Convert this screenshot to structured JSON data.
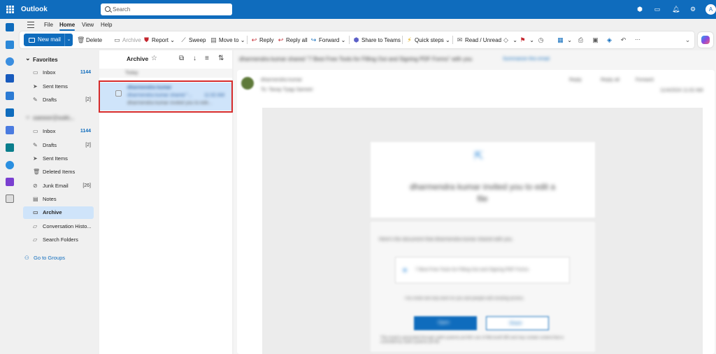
{
  "app": {
    "name": "Outlook",
    "search_placeholder": "Search",
    "avatar_letter": "A"
  },
  "tabs": [
    "File",
    "Home",
    "View",
    "Help"
  ],
  "ribbon": {
    "new_mail": "New mail",
    "delete": "Delete",
    "archive": "Archive",
    "report": "Report",
    "sweep": "Sweep",
    "move_to": "Move to",
    "reply": "Reply",
    "reply_all": "Reply all",
    "forward": "Forward",
    "share_to_teams": "Share to Teams",
    "quick_steps": "Quick steps",
    "read_unread": "Read / Unread",
    "more": "···"
  },
  "folders": {
    "favorites_header": "Favorites",
    "favorites": [
      {
        "label": "Inbox",
        "count": "1144"
      },
      {
        "label": "Sent Items",
        "count": ""
      },
      {
        "label": "Drafts",
        "count": "[2]"
      }
    ],
    "account_header": "sameer@sukt...",
    "account": [
      {
        "label": "Inbox",
        "count": "1144"
      },
      {
        "label": "Drafts",
        "count": "[2]"
      },
      {
        "label": "Sent Items",
        "count": ""
      },
      {
        "label": "Deleted Items",
        "count": ""
      },
      {
        "label": "Junk Email",
        "count": "[26]"
      },
      {
        "label": "Notes",
        "count": ""
      },
      {
        "label": "Archive",
        "count": ""
      },
      {
        "label": "Conversation Histo...",
        "count": ""
      },
      {
        "label": "Search Folders",
        "count": ""
      }
    ],
    "go_to_groups": "Go to Groups"
  },
  "list": {
    "title": "Archive",
    "group": "Today",
    "item": {
      "sender": "dharmendra kumar",
      "subject": "dharmendra kumar shared \"...",
      "time": "11:02 AM",
      "preview": "dharmendra kumar invited you to edit..."
    }
  },
  "reading": {
    "subject": "dharmendra kumar shared \"7 Best Free Tools for Filling Out and Signing PDF Forms\" with you",
    "summarize": "Summarize this email",
    "from": "dharmendra kumar",
    "to": "To: Tanay Tyagi   Sameer",
    "date": "11/4/2024 11:02 AM",
    "actions": [
      "Reply",
      "Reply all",
      "Forward"
    ],
    "invite": "dharmendra kumar invited you to edit a file",
    "shared_text": "Here's the document that dharmendra kumar shared with you.",
    "file_name": "7 Best Free Tools for Filling Out and Signing PDF Forms",
    "link_note": "This invite will only work for you and people with existing access.",
    "open": "Open",
    "share": "Share",
    "footer": "This email is generated through sukht systems pvt ltd's use of Microsoft 365 and may contain content that is controlled by sukht systems pvt ltd."
  }
}
